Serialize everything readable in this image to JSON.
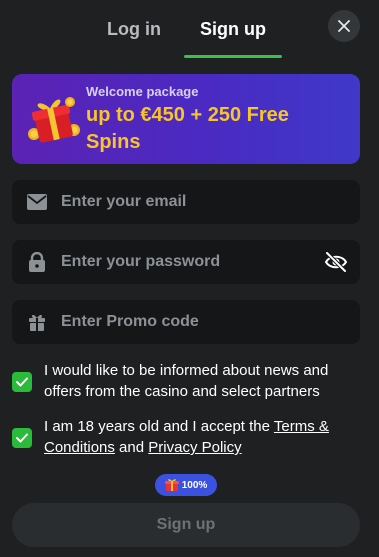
{
  "tabs": {
    "login_label": "Log in",
    "signup_label": "Sign up",
    "active": "signup"
  },
  "banner": {
    "small_text": "Welcome package",
    "big_text": "up to €450 + 250 Free Spins",
    "icon": "gift-box-icon"
  },
  "form": {
    "email": {
      "placeholder": "Enter your email",
      "value": "",
      "icon": "envelope-icon"
    },
    "password": {
      "placeholder": "Enter your password",
      "value": "",
      "icon": "lock-icon",
      "toggle_icon": "eye-off-icon"
    },
    "promo": {
      "placeholder": "Enter Promo code",
      "value": "",
      "icon": "gift-icon"
    }
  },
  "consents": {
    "news": {
      "checked": true,
      "text": "I would like to be informed about news and offers from the casino and select partners"
    },
    "age": {
      "checked": true,
      "text_before": "I am 18 years old and I accept the ",
      "terms_link": "Terms & Conditions",
      "text_middle": " and ",
      "privacy_link": "Privacy Policy"
    }
  },
  "submit": {
    "label": "Sign up",
    "badge_text": "100%",
    "badge_icon": "gift-icon"
  },
  "colors": {
    "accent_green": "#37c24b",
    "banner_gradient_start": "#5b22b4",
    "banner_gradient_end": "#3f38c8",
    "banner_highlight": "#f7c52b",
    "badge_blue": "#3b52e0"
  }
}
